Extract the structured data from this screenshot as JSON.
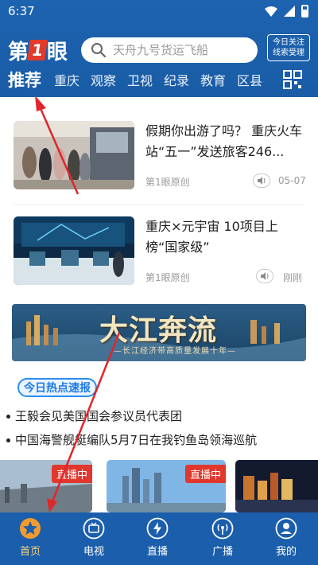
{
  "status_bar": {
    "time": "6:37"
  },
  "header": {
    "logo_text": "第1眼",
    "search_placeholder": "天舟九号货运飞船",
    "clue_button": {
      "line1": "今日关注",
      "line2": "线索受理"
    },
    "tabs": [
      {
        "label": "推荐",
        "active": true
      },
      {
        "label": "重庆"
      },
      {
        "label": "观察"
      },
      {
        "label": "卫视"
      },
      {
        "label": "纪录"
      },
      {
        "label": "教育"
      },
      {
        "label": "区县"
      }
    ]
  },
  "news": [
    {
      "title": "假期你出游了吗？ 重庆火车站“五一”发送旅客246...",
      "source": "第1眼原创",
      "time": "05-07"
    },
    {
      "title": "重庆×元宇宙 10项目上榜“国家级”",
      "source": "第1眼原创",
      "time": "刚刚"
    }
  ],
  "banner": {
    "title": "大江奔流",
    "subtitle": "—长江经济带高质量发展十年—"
  },
  "hot": {
    "badge": "今日热点速报",
    "items": [
      "王毅会见美国国会参议员代表团",
      "中国海警舰艇编队5月7日在我钓鱼岛领海巡航"
    ]
  },
  "live": {
    "tag": "直播中"
  },
  "bottom_nav": [
    {
      "label": "首页",
      "icon": "star-icon",
      "active": true
    },
    {
      "label": "电视",
      "icon": "tv-icon"
    },
    {
      "label": "直播",
      "icon": "lightning-icon"
    },
    {
      "label": "广播",
      "icon": "broadcast-icon"
    },
    {
      "label": "我的",
      "icon": "user-icon"
    }
  ],
  "colors": {
    "header_blue": "#1b5eac",
    "live_red": "#e1372d",
    "annotation_red": "#e0262b",
    "nav_active": "#ffd27a"
  }
}
